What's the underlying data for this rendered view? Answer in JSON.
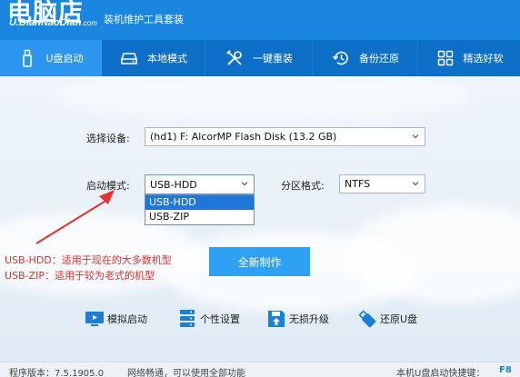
{
  "header": {
    "logo_main": "电脑店",
    "logo_sub_main": "U.DianNaoDian",
    "logo_sub_domain": ".com",
    "app_title": "装机维护工具套装"
  },
  "tabs": [
    {
      "label": "U盘启动",
      "icon": "usb-drive-icon",
      "active": true
    },
    {
      "label": "本地模式",
      "icon": "hard-disk-icon",
      "active": false
    },
    {
      "label": "一键重装",
      "icon": "tools-icon",
      "active": false
    },
    {
      "label": "备份还原",
      "icon": "history-icon",
      "active": false
    },
    {
      "label": "精选好软",
      "icon": "apps-grid-icon",
      "active": false
    }
  ],
  "form": {
    "device_label": "选择设备:",
    "device_value": "(hd1) F: AlcorMP Flash Disk (13.2 GB)",
    "boot_mode_label": "启动模式:",
    "boot_mode_value": "USB-HDD",
    "boot_mode_options": [
      "USB-HDD",
      "USB-ZIP"
    ],
    "partition_label": "分区格式:",
    "partition_value": "NTFS"
  },
  "annotation": {
    "line1": "USB-HDD：适用于现在的大多数机型",
    "line2": "USB-ZIP：适用于较为老式的机型",
    "color": "#e4312f"
  },
  "actions": {
    "create_label": "全新制作"
  },
  "tools": [
    {
      "label": "模拟启动",
      "icon": "monitor-play-icon"
    },
    {
      "label": "个性设置",
      "icon": "server-settings-icon"
    },
    {
      "label": "无损升级",
      "icon": "save-upgrade-icon"
    },
    {
      "label": "还原U盘",
      "icon": "usb-restore-icon"
    }
  ],
  "footer": {
    "version": "程序版本：7.5.1905.0",
    "network": "网络畅通，可以使用全部功能",
    "hotkey_label": "本机U盘启动快捷键：",
    "hotkey": "F8"
  },
  "colors": {
    "brand_blue": "#1b86e0",
    "tab_bar": "#0e6fc9",
    "active_tab": "#2b95f0",
    "primary_button": "#2fa1f4"
  }
}
